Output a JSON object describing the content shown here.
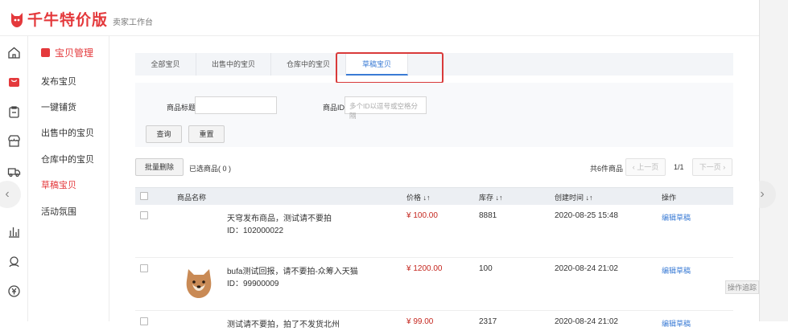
{
  "brand": {
    "name": "千牛特价版",
    "sub": "卖家工作台"
  },
  "rail_icons": [
    "home-icon",
    "bag-icon",
    "clipboard-icon",
    "store-icon",
    "truck-icon",
    "chart-icon",
    "customer-service-icon",
    "yuan-icon"
  ],
  "menu": {
    "title": "宝贝管理",
    "items": [
      {
        "label": "发布宝贝"
      },
      {
        "label": "一键铺货"
      },
      {
        "label": "出售中的宝贝"
      },
      {
        "label": "仓库中的宝贝"
      },
      {
        "label": "草稿宝贝"
      },
      {
        "label": "活动氛围"
      }
    ],
    "active_index": 4
  },
  "tabs": [
    {
      "label": "全部宝贝"
    },
    {
      "label": "出售中的宝贝"
    },
    {
      "label": "仓库中的宝贝"
    },
    {
      "label": "草稿宝贝"
    }
  ],
  "active_tab": 3,
  "filter": {
    "title_label": "商品标题",
    "title_value": "",
    "id_label": "商品ID",
    "id_placeholder": "多个ID以逗号或空格分隔",
    "query_button": "查询",
    "reset_button": "重置"
  },
  "toolbar": {
    "bulk_delete": "批量删除",
    "selected_text": "已选商品( 0 )",
    "total_text": "共6件商品",
    "prev_page": "上一页",
    "page_indicator": "1/1",
    "next_page": "下一页"
  },
  "table": {
    "headers": {
      "name": "商品名称",
      "price": "价格",
      "stock": "库存",
      "created": "创建时间",
      "action": "操作"
    },
    "rows": [
      {
        "title": "天穹发布商品，测试请不要拍",
        "id": "ID：102000022",
        "price": "¥ 100.00",
        "stock": "8881",
        "created": "2020-08-25 15:48",
        "action": "编辑草稿"
      },
      {
        "title": "bufa测试回报，请不要拍-众筹入天猫",
        "id": "ID：99900009",
        "price": "¥ 1200.00",
        "stock": "100",
        "created": "2020-08-24 21:02",
        "action": "编辑草稿"
      },
      {
        "title": "测试请不要拍，拍了不发货北州",
        "id": "",
        "price": "¥ 99.00",
        "stock": "2317",
        "created": "2020-08-24 21:02",
        "action": "编辑草稿"
      }
    ]
  },
  "float_tag": "操作追踪",
  "colors": {
    "accent": "#e4393c",
    "link": "#3a7bd5",
    "highlight_box": "#d93a3a",
    "price": "#c5271f"
  }
}
